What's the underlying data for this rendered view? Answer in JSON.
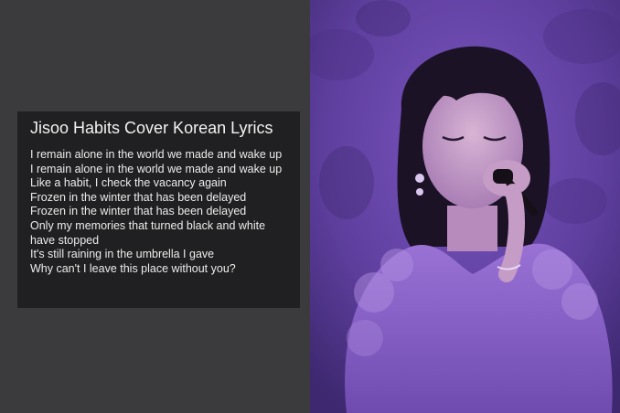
{
  "card": {
    "title": "Jisoo Habits Cover Korean Lyrics",
    "lines": [
      "I remain alone in the world we made and wake up",
      "I remain alone in the world we made and wake up",
      "Like a habit, I check the vacancy again",
      "Frozen in the winter that has been delayed",
      "Frozen in the winter that has been delayed",
      "Only my memories that turned black and white have stopped",
      "It's still raining in the umbrella I gave",
      "Why can't I leave this place without you?"
    ]
  },
  "photo": {
    "subject": "singer-with-microphone",
    "colors": {
      "background": "#6b48b0",
      "dress": "#8a62c8",
      "hair": "#1c1226",
      "skin": "#c9a0c8"
    }
  }
}
